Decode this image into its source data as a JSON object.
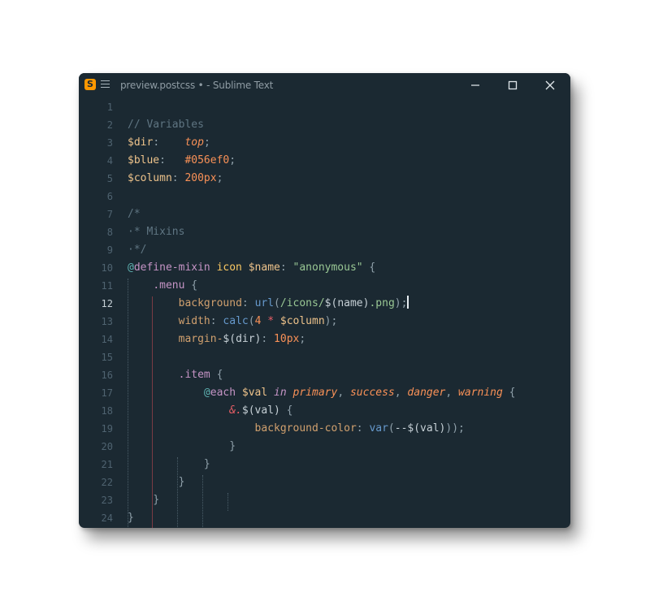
{
  "window": {
    "title": "preview.postcss • - Sublime Text",
    "app_icon_glyph": "S",
    "controls": [
      "minimize",
      "maximize",
      "close"
    ]
  },
  "colors": {
    "background": "#1b2932",
    "accent": "#ff9800",
    "comment": "#5f7582",
    "string": "#99c794",
    "number": "#f99157"
  },
  "editor": {
    "active_line": 12,
    "line_numbers": [
      "1",
      "2",
      "3",
      "4",
      "5",
      "6",
      "7",
      "8",
      "9",
      "10",
      "11",
      "12",
      "13",
      "14",
      "15",
      "16",
      "17",
      "18",
      "19",
      "20",
      "21",
      "22",
      "23",
      "24"
    ],
    "lines": [
      [],
      [
        {
          "t": "// Variables",
          "c": "c-comment"
        }
      ],
      [
        {
          "t": "$dir",
          "c": "c-var"
        },
        {
          "t": ":    ",
          "c": "c-punc"
        },
        {
          "t": "top",
          "c": "c-val-italic"
        },
        {
          "t": ";",
          "c": "c-punc"
        }
      ],
      [
        {
          "t": "$blue",
          "c": "c-var"
        },
        {
          "t": ":   ",
          "c": "c-punc"
        },
        {
          "t": "#056ef0",
          "c": "c-num"
        },
        {
          "t": ";",
          "c": "c-punc"
        }
      ],
      [
        {
          "t": "$column",
          "c": "c-var"
        },
        {
          "t": ": ",
          "c": "c-punc"
        },
        {
          "t": "200px",
          "c": "c-num"
        },
        {
          "t": ";",
          "c": "c-punc"
        }
      ],
      [],
      [
        {
          "t": "/*",
          "c": "c-comment"
        }
      ],
      [
        {
          "t": "·* Mixins",
          "c": "c-comment"
        }
      ],
      [
        {
          "t": "·*/",
          "c": "c-comment"
        }
      ],
      [
        {
          "t": "@",
          "c": "c-at-sym"
        },
        {
          "t": "define-mixin",
          "c": "c-at"
        },
        {
          "t": " ",
          "c": "c-plain"
        },
        {
          "t": "icon",
          "c": "c-fn-name"
        },
        {
          "t": " ",
          "c": "c-plain"
        },
        {
          "t": "$name",
          "c": "c-var"
        },
        {
          "t": ": ",
          "c": "c-punc"
        },
        {
          "t": "\"anonymous\"",
          "c": "c-string"
        },
        {
          "t": " {",
          "c": "c-punc"
        }
      ],
      [
        {
          "t": "    ",
          "c": "c-plain"
        },
        {
          "t": ".menu",
          "c": "c-selector"
        },
        {
          "t": " {",
          "c": "c-punc"
        }
      ],
      [
        {
          "t": "        ",
          "c": "c-plain"
        },
        {
          "t": "background",
          "c": "c-prop"
        },
        {
          "t": ": ",
          "c": "c-punc"
        },
        {
          "t": "url",
          "c": "c-fn"
        },
        {
          "t": "(",
          "c": "c-punc"
        },
        {
          "t": "/icons/",
          "c": "c-string"
        },
        {
          "t": "$(name)",
          "c": "c-plain"
        },
        {
          "t": ".png",
          "c": "c-string"
        },
        {
          "t": ");",
          "c": "c-punc"
        },
        {
          "caret": true
        }
      ],
      [
        {
          "t": "        ",
          "c": "c-plain"
        },
        {
          "t": "width",
          "c": "c-prop"
        },
        {
          "t": ": ",
          "c": "c-punc"
        },
        {
          "t": "calc",
          "c": "c-fn"
        },
        {
          "t": "(",
          "c": "c-punc"
        },
        {
          "t": "4",
          "c": "c-num"
        },
        {
          "t": " ",
          "c": "c-plain"
        },
        {
          "t": "*",
          "c": "c-op"
        },
        {
          "t": " ",
          "c": "c-plain"
        },
        {
          "t": "$column",
          "c": "c-var"
        },
        {
          "t": ");",
          "c": "c-punc"
        }
      ],
      [
        {
          "t": "        ",
          "c": "c-plain"
        },
        {
          "t": "margin-",
          "c": "c-prop"
        },
        {
          "t": "$(dir)",
          "c": "c-plain"
        },
        {
          "t": ": ",
          "c": "c-punc"
        },
        {
          "t": "10px",
          "c": "c-num"
        },
        {
          "t": ";",
          "c": "c-punc"
        }
      ],
      [],
      [
        {
          "t": "        ",
          "c": "c-plain"
        },
        {
          "t": ".item",
          "c": "c-selector"
        },
        {
          "t": " {",
          "c": "c-punc"
        }
      ],
      [
        {
          "t": "            ",
          "c": "c-plain"
        },
        {
          "t": "@",
          "c": "c-at-sym"
        },
        {
          "t": "each",
          "c": "c-at"
        },
        {
          "t": " ",
          "c": "c-plain"
        },
        {
          "t": "$val",
          "c": "c-var"
        },
        {
          "t": " ",
          "c": "c-plain"
        },
        {
          "t": "in",
          "c": "c-kw-italic"
        },
        {
          "t": " ",
          "c": "c-plain"
        },
        {
          "t": "primary",
          "c": "c-val-italic"
        },
        {
          "t": ", ",
          "c": "c-punc"
        },
        {
          "t": "success",
          "c": "c-val-italic"
        },
        {
          "t": ", ",
          "c": "c-punc"
        },
        {
          "t": "danger",
          "c": "c-val-italic"
        },
        {
          "t": ", ",
          "c": "c-punc"
        },
        {
          "t": "warning",
          "c": "c-val-italic"
        },
        {
          "t": " {",
          "c": "c-punc"
        }
      ],
      [
        {
          "t": "                ",
          "c": "c-plain"
        },
        {
          "t": "&.",
          "c": "c-amp"
        },
        {
          "t": "$(val)",
          "c": "c-plain"
        },
        {
          "t": " {",
          "c": "c-punc"
        }
      ],
      [
        {
          "t": "                    ",
          "c": "c-plain"
        },
        {
          "t": "background-color",
          "c": "c-prop"
        },
        {
          "t": ": ",
          "c": "c-punc"
        },
        {
          "t": "var",
          "c": "c-fn"
        },
        {
          "t": "(",
          "c": "c-punc"
        },
        {
          "t": "--",
          "c": "c-plain"
        },
        {
          "t": "$(val)",
          "c": "c-plain"
        },
        {
          "t": "));",
          "c": "c-punc"
        }
      ],
      [
        {
          "t": "                ",
          "c": "c-plain"
        },
        {
          "t": "}",
          "c": "c-punc"
        }
      ],
      [
        {
          "t": "            ",
          "c": "c-plain"
        },
        {
          "t": "}",
          "c": "c-punc"
        }
      ],
      [
        {
          "t": "        ",
          "c": "c-plain"
        },
        {
          "t": "}",
          "c": "c-punc"
        }
      ],
      [
        {
          "t": "    ",
          "c": "c-plain"
        },
        {
          "t": "}",
          "c": "c-punc"
        }
      ],
      [
        {
          "t": "}",
          "c": "c-punc"
        }
      ]
    ]
  }
}
